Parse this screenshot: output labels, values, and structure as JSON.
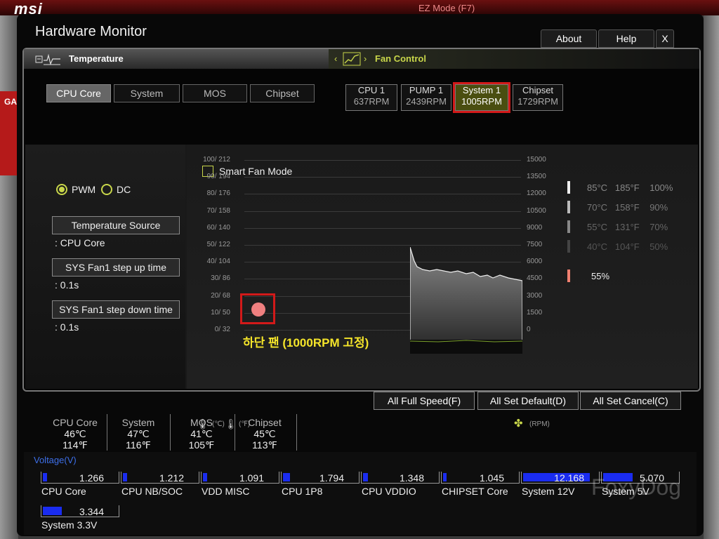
{
  "window": {
    "title": "Hardware Monitor"
  },
  "topbar": {
    "about": "About",
    "help": "Help",
    "close": "X"
  },
  "background": {
    "logo": "msi",
    "mode": "EZ Mode (F7)",
    "side_tab": "GA"
  },
  "temperature": {
    "header": "Temperature",
    "sources": [
      "CPU Core",
      "System",
      "MOS",
      "Chipset"
    ],
    "active": "CPU Core"
  },
  "fan_control": {
    "header": "Fan Control",
    "fans": [
      {
        "name": "CPU 1",
        "rpm": "637RPM"
      },
      {
        "name": "PUMP 1",
        "rpm": "2439RPM"
      },
      {
        "name": "System 1",
        "rpm": "1005RPM"
      },
      {
        "name": "Chipset",
        "rpm": "1729RPM"
      }
    ],
    "selected": "System 1"
  },
  "mode": {
    "pwm": "PWM",
    "dc": "DC",
    "selected": "PWM"
  },
  "settings": {
    "temp_source_label": "Temperature Source",
    "temp_source_value": ": CPU Core",
    "step_up_label": "SYS Fan1 step up time",
    "step_up_value": ": 0.1s",
    "step_down_label": "SYS Fan1 step down time",
    "step_down_value": ": 0.1s"
  },
  "graph": {
    "smart_fan_label": "Smart Fan Mode",
    "smart_fan_checked": false,
    "annotation": "하단 팬 (1000RPM 고정)",
    "left_axis": [
      "100/ 212",
      "90/ 194",
      "80/ 176",
      "70/ 158",
      "60/ 140",
      "50/ 122",
      "40/ 104",
      "30/  86",
      "20/  68",
      "10/  50",
      "0/  32"
    ],
    "right_axis": [
      "15000",
      "13500",
      "12000",
      "10500",
      "9000",
      "7500",
      "6000",
      "4500",
      "3000",
      "1500",
      "0"
    ],
    "unit_c": "(℃)",
    "unit_f": "(℉)",
    "unit_rpm": "(RPM)",
    "legend": [
      {
        "c": "85°C",
        "f": "185°F",
        "pct": "100%"
      },
      {
        "c": "70°C",
        "f": "158°F",
        "pct": "90%"
      },
      {
        "c": "55°C",
        "f": "131°F",
        "pct": "70%"
      },
      {
        "c": "40°C",
        "f": "104°F",
        "pct": "50%"
      }
    ],
    "current_pct": "55%"
  },
  "actions": {
    "full_speed": "All Full Speed(F)",
    "set_default": "All Set Default(D)",
    "set_cancel": "All Set Cancel(C)"
  },
  "temps": [
    {
      "name": "CPU Core",
      "c": "46℃",
      "f": "114℉"
    },
    {
      "name": "System",
      "c": "47℃",
      "f": "116℉"
    },
    {
      "name": "MOS",
      "c": "41℃",
      "f": "105℉"
    },
    {
      "name": "Chipset",
      "c": "45℃",
      "f": "113℉"
    }
  ],
  "voltage": {
    "header": "Voltage(V)",
    "items": [
      {
        "name": "CPU Core",
        "value": "1.266",
        "level": 0.06
      },
      {
        "name": "CPU NB/SOC",
        "value": "1.212",
        "level": 0.06
      },
      {
        "name": "VDD MISC",
        "value": "1.091",
        "level": 0.06
      },
      {
        "name": "CPU 1P8",
        "value": "1.794",
        "level": 0.09
      },
      {
        "name": "CPU VDDIO",
        "value": "1.348",
        "level": 0.07
      },
      {
        "name": "CHIPSET Core",
        "value": "1.045",
        "level": 0.05
      },
      {
        "name": "System 12V",
        "value": "12.168",
        "level": 0.9
      },
      {
        "name": "System 5V",
        "value": "5.070",
        "level": 0.4
      },
      {
        "name": "System 3.3V",
        "value": "3.344",
        "level": 0.25
      }
    ]
  },
  "watermark": "FoxyDog",
  "colors": {
    "accent": "#c8d64a",
    "selected_fan_bg": "#4a4e10",
    "highlight": "#d21919",
    "voltage_fill": "#1a2cf0",
    "voltage_header": "#3d6fe8"
  }
}
